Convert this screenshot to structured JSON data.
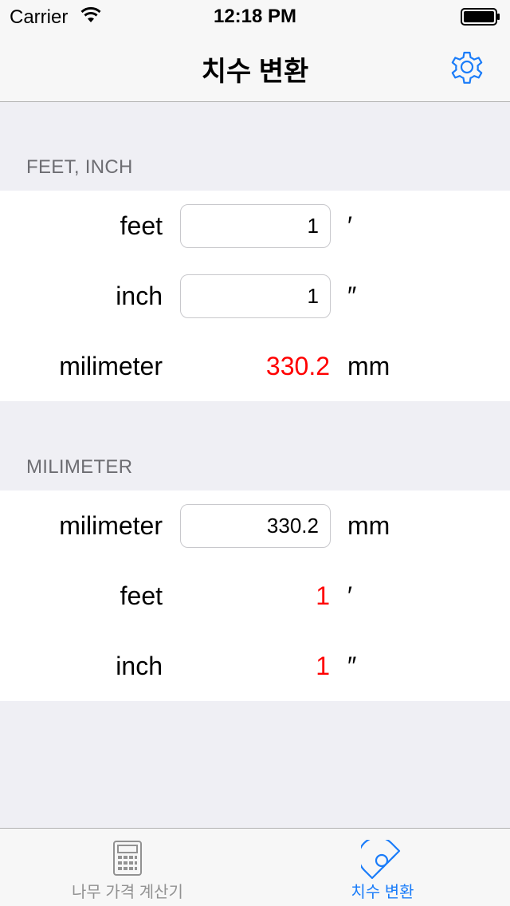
{
  "status_bar": {
    "carrier": "Carrier",
    "time": "12:18 PM",
    "icons": [
      "wifi-icon",
      "battery-icon"
    ]
  },
  "nav": {
    "title": "치수 변환",
    "settings_icon": "gear-icon",
    "accent_color": "#1a7cf9"
  },
  "sections": {
    "feet_inch": {
      "header": "FEET, INCH",
      "rows": {
        "feet": {
          "label": "feet",
          "value": "1",
          "unit": "′"
        },
        "inch": {
          "label": "inch",
          "value": "1",
          "unit": "″"
        },
        "mm": {
          "label": "milimeter",
          "value": "330.2",
          "unit": "mm"
        }
      }
    },
    "milimeter": {
      "header": "MILIMETER",
      "rows": {
        "mm": {
          "label": "milimeter",
          "value": "330.2",
          "unit": "mm"
        },
        "feet": {
          "label": "feet",
          "value": "1",
          "unit": "′"
        },
        "inch": {
          "label": "inch",
          "value": "1",
          "unit": "″"
        }
      }
    }
  },
  "colors": {
    "result": "#ff0000",
    "background": "#efeff4",
    "tab_active": "#1a7cf9",
    "tab_inactive": "#929292"
  },
  "tab_bar": {
    "tabs": [
      {
        "label": "나무 가격 계산기",
        "icon": "calculator-icon",
        "active": false
      },
      {
        "label": "치수 변환",
        "icon": "protractor-icon",
        "active": true
      }
    ]
  }
}
